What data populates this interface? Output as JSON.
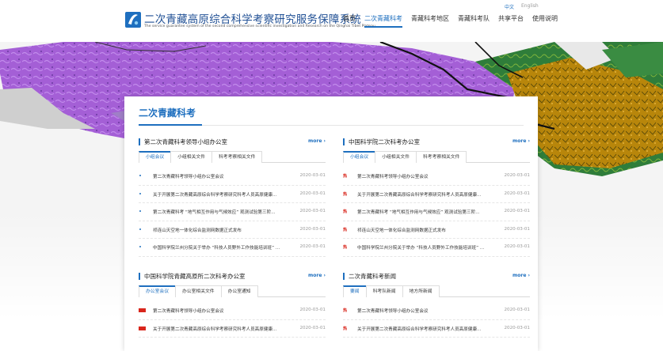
{
  "header": {
    "title": "二次青藏高原综合科学考察研究服务保障系统",
    "subtitle": "The service guarantee system of the second comprehensive scientific investigation and Research on the Qinghai Tibet Plateau",
    "lang_zh": "中文",
    "lang_en": "English",
    "nav": [
      "首页",
      "二次青藏科考",
      "青藏科考地区",
      "青藏科考队",
      "共享平台",
      "使用说明"
    ],
    "active_nav": "二次青藏科考"
  },
  "colors": {
    "accent": "#1e6fbf",
    "hot": "#d9261c",
    "map_purple": "#a45fd6",
    "map_brown": "#b8860b"
  },
  "card": {
    "title": "二次青藏科考"
  },
  "panels": [
    {
      "title": "第二次青藏科考领导小组办公室",
      "more": "more ›",
      "tabs": [
        "小组会议",
        "小组相关文件",
        "科考考察相关文件"
      ],
      "marker": "dot",
      "items": [
        {
          "text": "第二次青藏科考领导小组办公室会议",
          "date": "2020-03-01"
        },
        {
          "text": "关于开展第二次青藏高原综合科学考察研究科考人员高原健康...",
          "date": "2020-03-01"
        },
        {
          "text": "第二次青藏科考 “地气相互作用与气候效应” 观测试验第三阶...",
          "date": "2020-03-01"
        },
        {
          "text": "祁连山天空地一体化综合监测网数据正式发布",
          "date": "2020-03-01"
        },
        {
          "text": "中国科学院兰州分院关于举办 “科技人员野外工作技能培训班” ...",
          "date": "2020-03-01"
        }
      ]
    },
    {
      "title": "中国科学院二次科考办公室",
      "more": "more ›",
      "tabs": [
        "小组会议",
        "小组相关文件",
        "科考考察相关文件"
      ],
      "marker": "hot",
      "hot_label": "热",
      "items": [
        {
          "text": "第二次青藏科考领导小组办公室会议",
          "date": "2020-03-01"
        },
        {
          "text": "关于开展第二次青藏高原综合科学考察研究科考人员高原健康...",
          "date": "2020-03-01"
        },
        {
          "text": "第二次青藏科考 “地气相互作用与气候效应” 观测试验第三阶...",
          "date": "2020-03-01"
        },
        {
          "text": "祁连山天空地一体化综合监测网数据正式发布",
          "date": "2020-03-01"
        },
        {
          "text": "中国科学院兰州分院关于举办 “科技人员野外工作技能培训班” ...",
          "date": "2020-03-01"
        }
      ]
    },
    {
      "title": "中国科学院青藏高原所二次科考办公室",
      "more": "more ›",
      "tabs": [
        "办公室会议",
        "办公室相关文件",
        "办公室通知"
      ],
      "marker": "new",
      "items": [
        {
          "text": "第二次青藏科考领导小组办公室会议",
          "date": "2020-03-01"
        },
        {
          "text": "关于开展第二次青藏高原综合科学考察研究科考人员高原健康...",
          "date": "2020-03-01"
        }
      ]
    },
    {
      "title": "二次青藏科考新闻",
      "more": "more ›",
      "tabs": [
        "要闻",
        "科考队新闻",
        "地方所新闻"
      ],
      "marker": "hot",
      "hot_label": "热",
      "items": [
        {
          "text": "第二次青藏科考领导小组办公室会议",
          "date": "2020-03-01"
        },
        {
          "text": "关于开展第二次青藏高原综合科学考察研究科考人员高原健康...",
          "date": "2020-03-01"
        }
      ]
    }
  ]
}
